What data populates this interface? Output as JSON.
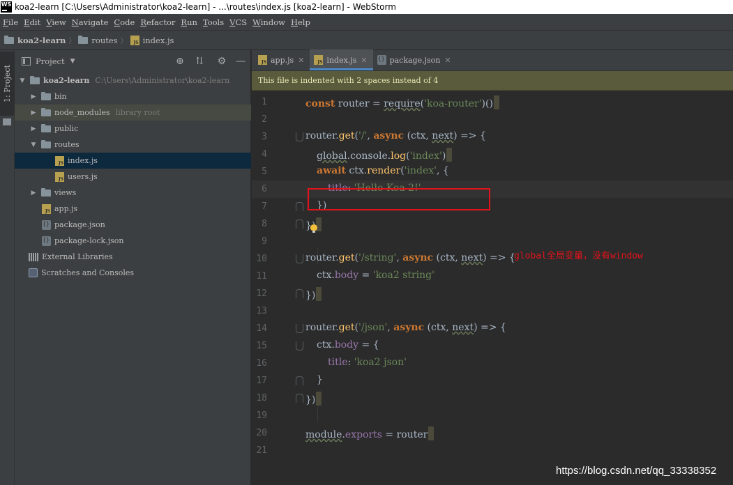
{
  "window": {
    "logo": "WS",
    "title": "koa2-learn [C:\\Users\\Administrator\\koa2-learn] - ...\\routes\\index.js [koa2-learn] - WebStorm"
  },
  "menu": [
    {
      "u": "F",
      "rest": "ile"
    },
    {
      "u": "E",
      "rest": "dit"
    },
    {
      "u": "V",
      "rest": "iew"
    },
    {
      "u": "N",
      "rest": "avigate"
    },
    {
      "u": "C",
      "rest": "ode"
    },
    {
      "u": "R",
      "rest": "efactor"
    },
    {
      "u": "R",
      "rest": "un"
    },
    {
      "u": "T",
      "rest": "ools"
    },
    {
      "u": "V",
      "rest": "CS"
    },
    {
      "u": "W",
      "rest": "indow"
    },
    {
      "u": "H",
      "rest": "elp"
    }
  ],
  "breadcrumb": [
    "koa2-learn",
    "routes",
    "index.js"
  ],
  "toolstrip": {
    "project_tab": "1: Project"
  },
  "project_panel": {
    "title": "Project",
    "tree": {
      "root": {
        "label": "koa2-learn",
        "path": "C:\\Users\\Administrator\\koa2-learn"
      },
      "bin": "bin",
      "node_modules": {
        "label": "node_modules",
        "hint": "library root"
      },
      "public": "public",
      "routes": "routes",
      "index_js": "index.js",
      "users_js": "users.js",
      "views": "views",
      "app_js": "app.js",
      "package_json": "package.json",
      "package_lock_json": "package-lock.json",
      "external_libraries": "External Libraries",
      "scratches": "Scratches and Consoles"
    }
  },
  "editor": {
    "tabs": [
      {
        "label": "app.js"
      },
      {
        "label": "index.js"
      },
      {
        "label": "package.json"
      }
    ],
    "notice": "This file is indented with 2 spaces instead of 4",
    "line_numbers": [
      "1",
      "2",
      "3",
      "4",
      "5",
      "6",
      "7",
      "8",
      "9",
      "10",
      "11",
      "12",
      "13",
      "14",
      "15",
      "16",
      "17",
      "18",
      "19",
      "20",
      "21"
    ],
    "code": {
      "l1": {
        "kw": "const",
        "a": " router = ",
        "fn": "require",
        "b": "(",
        "str": "'koa-router'",
        "c": ")()"
      },
      "l3": {
        "a": "router.",
        "fn": "get",
        "b": "(",
        "str": "'/'",
        "c": ", ",
        "kw": "async",
        "d": " (ctx, ",
        "e": "next",
        "f": ") => {"
      },
      "l4": {
        "a": "global",
        "b": ".console.",
        "fn": "log",
        "c": "(",
        "str": "'index'",
        "d": ")"
      },
      "l5": {
        "kw": "await",
        "a": " ctx.",
        "fn": "render",
        "b": "(",
        "str": "'index'",
        "c": ", {"
      },
      "l6": {
        "prop": "title",
        "a": ": ",
        "str": "'Hello Koa 2!'"
      },
      "l7": {
        "a": "})"
      },
      "l8": {
        "a": "})"
      },
      "l10": {
        "a": "router.",
        "fn": "get",
        "b": "(",
        "str": "'/string'",
        "c": ", ",
        "kw": "async",
        "d": " (ctx, ",
        "e": "next",
        "f": ") => {"
      },
      "l11": {
        "a": "ctx.",
        "prop": "body",
        "b": " = ",
        "str": "'koa2 string'"
      },
      "l12": {
        "a": "})"
      },
      "l14": {
        "a": "router.",
        "fn": "get",
        "b": "(",
        "str": "'/json'",
        "c": ", ",
        "kw": "async",
        "d": " (ctx, ",
        "e": "next",
        "f": ") => {"
      },
      "l15": {
        "a": "ctx.",
        "prop": "body",
        "b": " = {"
      },
      "l16": {
        "prop": "title",
        "a": ": ",
        "str": "'koa2 json'"
      },
      "l17": {
        "a": "}"
      },
      "l18": {
        "a": "})"
      },
      "l20": {
        "a": "module",
        "b": ".",
        "prop": "exports",
        "c": " = router"
      }
    },
    "annotation": "global全局变量，没有window"
  },
  "watermark": "https://blog.csdn.net/qq_33338352",
  "colors": {
    "keyword": "#cc7832",
    "string": "#6a8759",
    "function": "#ffc66d",
    "property": "#9876aa",
    "annotation_red": "#e3131b",
    "selection": "#0d293e"
  }
}
